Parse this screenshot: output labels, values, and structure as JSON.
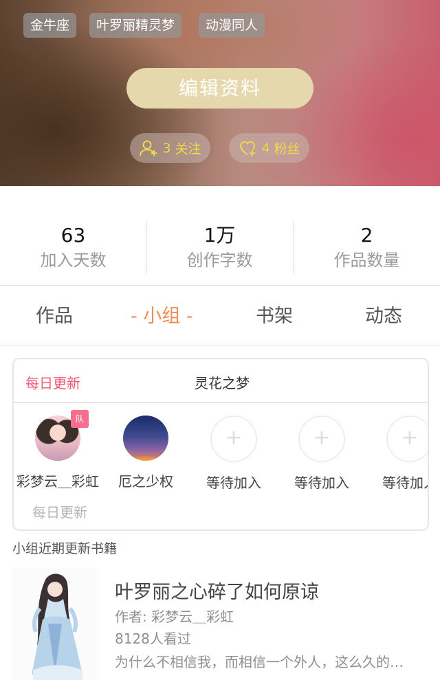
{
  "header": {
    "tags": [
      "金牛座",
      "叶罗丽精灵梦",
      "动漫同人"
    ],
    "edit_button": "编辑资料",
    "follow": {
      "count": "3",
      "label": "关注",
      "icon": "add-user-icon"
    },
    "fans": {
      "count": "4",
      "label": "粉丝",
      "icon": "heart-plus-icon"
    },
    "accent_color": "#f1d74e"
  },
  "stats": [
    {
      "value": "63",
      "label": "加入天数"
    },
    {
      "value": "1万",
      "label": "创作字数"
    },
    {
      "value": "2",
      "label": "作品数量"
    }
  ],
  "tabs": [
    {
      "label": "作品",
      "active": false
    },
    {
      "label": "- 小组 -",
      "active": true
    },
    {
      "label": "书架",
      "active": false
    },
    {
      "label": "动态",
      "active": false
    }
  ],
  "group": {
    "tag": "每日更新",
    "name": "灵花之梦",
    "members": [
      {
        "name": "彩梦云＿彩虹",
        "badge": "队",
        "avatar": "girl"
      },
      {
        "name": "厄之少权",
        "avatar": "sky"
      },
      {
        "name": "等待加入",
        "avatar": "empty"
      },
      {
        "name": "等待加入",
        "avatar": "empty"
      },
      {
        "name": "等待加入",
        "avatar": "empty"
      }
    ],
    "add_symbol": "+",
    "footer": "每日更新"
  },
  "recent": {
    "title": "小组近期更新书籍",
    "book": {
      "title": "叶罗丽之心碎了如何原谅",
      "author": "作者: 彩梦云＿彩虹",
      "views": "8128人看过",
      "desc": "为什么不相信我，而相信一个外人，这么久的…"
    }
  },
  "colors": {
    "tab_active": "#f08c4e",
    "group_tag": "#f25a76",
    "badge": "#f56d8f"
  }
}
